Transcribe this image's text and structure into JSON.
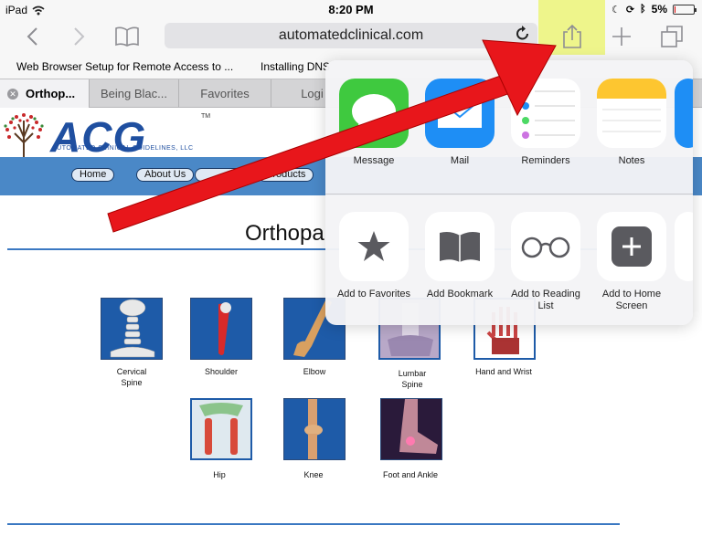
{
  "status_bar": {
    "device": "iPad",
    "time": "8:20 PM",
    "battery": "5%",
    "battery_level": 0.05
  },
  "toolbar": {
    "url": "automatedclinical.com",
    "icons": [
      "back-icon",
      "forward-icon",
      "bookmarks-icon",
      "reload-icon",
      "share-icon",
      "new-tab-icon",
      "tabs-icon"
    ]
  },
  "bookmarks_bar": {
    "items": [
      "Web Browser Setup for Remote Access to ...",
      "Installing DNS"
    ]
  },
  "tabs": [
    {
      "label": "Orthop...",
      "active": true
    },
    {
      "label": "Being Blac...",
      "active": false
    },
    {
      "label": "Favorites",
      "active": false
    },
    {
      "label": "Logi",
      "active": false
    }
  ],
  "site": {
    "logo": "ACG",
    "logo_subtitle": "AUTOMATED CLINICAL GUIDELINES, LLC",
    "logo_tm": "TM",
    "nav": [
      "Home",
      "About Us",
      "Products"
    ],
    "page_title": "Orthopa",
    "body_parts": [
      {
        "label": "Cervical Spine",
        "line1": "Cervical",
        "line2": "Spine"
      },
      {
        "label": "Shoulder",
        "line1": "Shoulder",
        "line2": ""
      },
      {
        "label": "Elbow",
        "line1": "Elbow",
        "line2": ""
      },
      {
        "label": "Lumbar Spine",
        "line1": "Lumbar",
        "line2": "Spine"
      },
      {
        "label": "Hand and Wrist",
        "line1": "Hand and Wrist",
        "line2": ""
      },
      {
        "label": "Hip",
        "line1": "Hip",
        "line2": ""
      },
      {
        "label": "Knee",
        "line1": "Knee",
        "line2": ""
      },
      {
        "label": "Foot and Ankle",
        "line1": "Foot and Ankle",
        "line2": ""
      }
    ]
  },
  "share_sheet": {
    "apps": [
      {
        "label": "Message",
        "icon": "messages-icon"
      },
      {
        "label": "Mail",
        "icon": "mail-icon"
      },
      {
        "label": "Reminders",
        "icon": "reminders-icon"
      },
      {
        "label": "Notes",
        "icon": "notes-icon"
      }
    ],
    "actions": [
      {
        "label": "Add to Favorites",
        "icon": "star-icon"
      },
      {
        "label": "Add Bookmark",
        "icon": "book-icon"
      },
      {
        "label": "Add to Reading List",
        "icon": "glasses-icon"
      },
      {
        "label": "Add to Home Screen",
        "icon": "plus-icon"
      }
    ]
  },
  "colors": {
    "share_highlight": "#ecf578",
    "arrow": "#e8161b",
    "nav_bar": "#4a88c7",
    "logo": "#1f4fa0"
  }
}
